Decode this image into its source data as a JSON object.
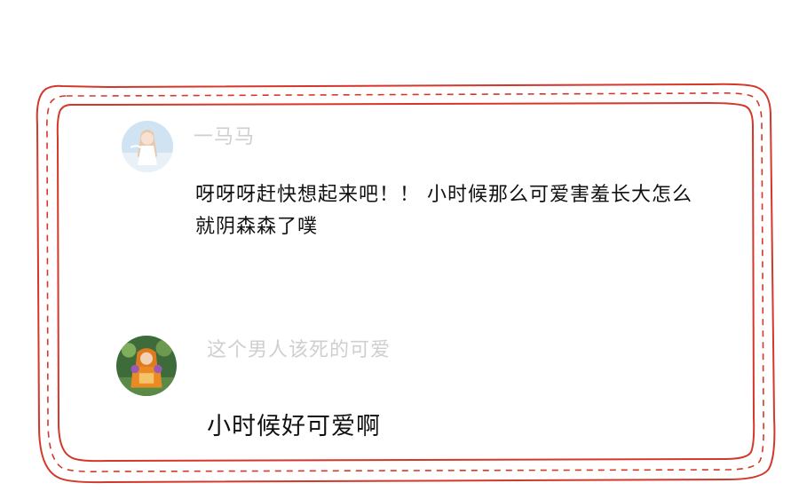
{
  "colors": {
    "frame": "#d4382b",
    "username": "#cfcfcf",
    "text": "#111111",
    "background": "#ffffff"
  },
  "comments": [
    {
      "avatar_icon": "anime-girl-avatar-icon",
      "username": "一马马",
      "text": "呀呀呀赶快想起来吧！！ 小时候那么可爱害羞长大怎么就阴森森了噗"
    },
    {
      "avatar_icon": "costumed-child-avatar-icon",
      "username": "这个男人该死的可爱",
      "text": "小时候好可爱啊"
    }
  ]
}
